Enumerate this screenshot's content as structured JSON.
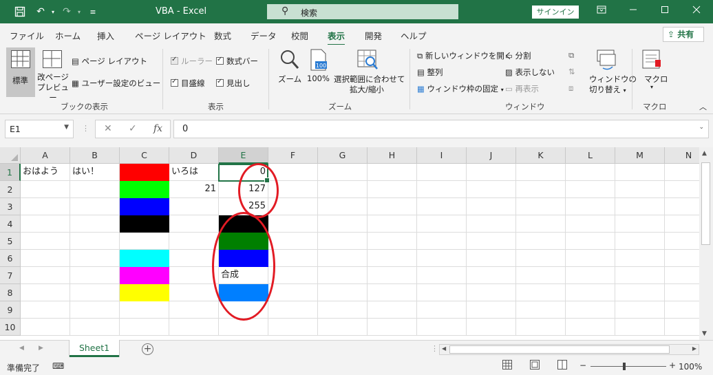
{
  "window": {
    "title": "VBA  -  Excel",
    "search_placeholder": "検索",
    "signin": "サインイン"
  },
  "tabs": [
    "ファイル",
    "ホーム",
    "挿入",
    "ページ レイアウト",
    "数式",
    "データ",
    "校閲",
    "表示",
    "開発",
    "ヘルプ"
  ],
  "active_tab": "表示",
  "share_label": "共有",
  "ribbon": {
    "book_views": {
      "label": "ブックの表示",
      "normal": "標準",
      "page_break": "改ページ\nプレビュー",
      "page_layout": "ページ レイアウト",
      "custom_views": "ユーザー設定のビュー"
    },
    "show": {
      "label": "表示",
      "ruler": "ルーラー",
      "formula_bar": "数式バー",
      "gridlines": "目盛線",
      "headings": "見出し"
    },
    "zoom": {
      "label": "ズーム",
      "zoom": "ズーム",
      "hundred": "100%",
      "zoom_selection_line1": "選択範囲に合わせて",
      "zoom_selection_line2": "拡大/縮小"
    },
    "window": {
      "label": "ウィンドウ",
      "new_window": "新しいウィンドウを開く",
      "arrange": "整列",
      "freeze": "ウィンドウ枠の固定",
      "split": "分割",
      "hide": "表示しない",
      "unhide": "再表示",
      "switch_line1": "ウィンドウの",
      "switch_line2": "切り替え"
    },
    "macros": {
      "label": "マクロ",
      "macro": "マクロ"
    }
  },
  "formula_bar": {
    "name_box": "E1",
    "value": "0",
    "fx": "fx"
  },
  "columns": [
    "A",
    "B",
    "C",
    "D",
    "E",
    "F",
    "G",
    "H",
    "I",
    "J",
    "K",
    "L",
    "M",
    "N"
  ],
  "rows": [
    "1",
    "2",
    "3",
    "4",
    "5",
    "6",
    "7",
    "8",
    "9",
    "10"
  ],
  "selected_cell": "E1",
  "cells": {
    "A1": "おはよう",
    "B1": "はい！",
    "D1": "いろは",
    "E1": "0",
    "D2": "21",
    "E2": "127",
    "E3": "255",
    "E7": "合成"
  },
  "cell_fills": {
    "C1": "#ff0000",
    "C2": "#00ff00",
    "C3": "#0000ff",
    "C4": "#000000",
    "C6": "#00ffff",
    "C7": "#ff00ff",
    "C8": "#ffff00",
    "E4": "#000000",
    "E5": "#007f00",
    "E6": "#0000ff",
    "E8": "#007fff"
  },
  "annotation_color": "#e21b24",
  "sheets": [
    "Sheet1"
  ],
  "status": {
    "ready": "準備完了",
    "zoom": "100%"
  }
}
